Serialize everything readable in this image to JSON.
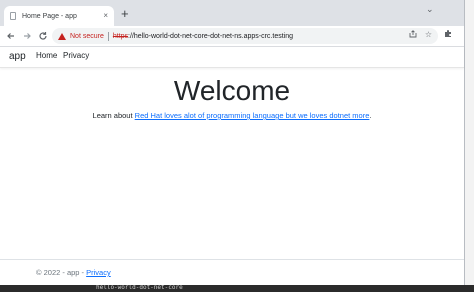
{
  "browser": {
    "tab_title": "Home Page - app",
    "tab_close": "×",
    "new_tab": "+",
    "security_label": "Not secure",
    "url_scheme": "https",
    "url_rest": "://hello-world-dot-net-core-dot-net-ns.apps-crc.testing",
    "icons": {
      "back": "arrow-left-icon",
      "forward": "arrow-right-icon",
      "reload": "reload-icon",
      "warning": "warning-triangle-icon",
      "share": "share-icon",
      "bookmark": "star-icon",
      "extensions": "puzzle-icon",
      "profile": "profile-icon",
      "tab_search": "chevron-down-icon"
    }
  },
  "site": {
    "brand": "app",
    "nav": [
      "Home",
      "Privacy"
    ],
    "heading": "Welcome",
    "learn_prefix": "Learn about ",
    "learn_link": "Red Hat loves alot of programming language but we loves dotnet more",
    "learn_suffix": ".",
    "footer_prefix": "© 2022 - app - ",
    "footer_link": "Privacy"
  },
  "background": {
    "terminal_text": "hello-world-dot-net-core"
  },
  "colors": {
    "link": "#0d6efd",
    "warning": "#c5221f",
    "tabstrip": "#dee1e6"
  }
}
